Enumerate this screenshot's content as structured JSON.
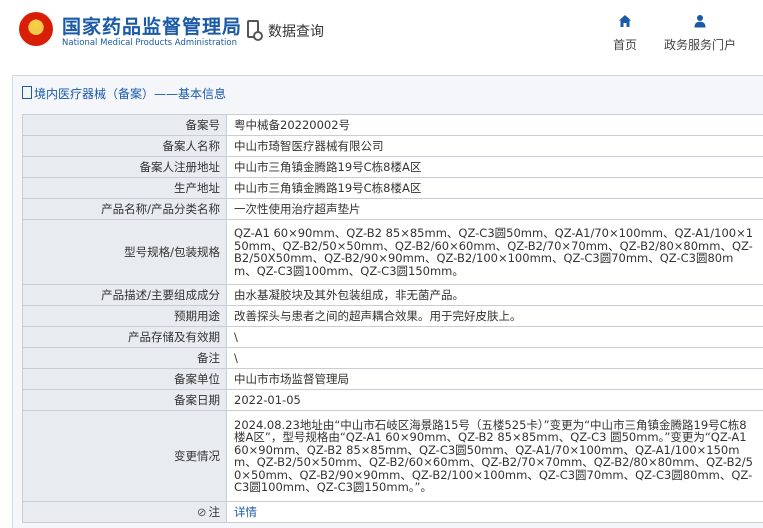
{
  "header": {
    "title": "国家药品监督管理局",
    "subtitle": "National Medical Products Administration",
    "query_label": "数据查询",
    "nav": {
      "home": "首页",
      "gov_portal": "政务服务门户"
    }
  },
  "panel": {
    "title": "境内医疗器械（备案）——基本信息",
    "rows": [
      {
        "label": "备案号",
        "value": "粤中械备20220002号"
      },
      {
        "label": "备案人名称",
        "value": "中山市琦智医疗器械有限公司"
      },
      {
        "label": "备案人注册地址",
        "value": "中山市三角镇金腾路19号C栋8楼A区"
      },
      {
        "label": "生产地址",
        "value": "中山市三角镇金腾路19号C栋8楼A区"
      },
      {
        "label": "产品名称/产品分类名称",
        "value": "一次性使用治疗超声垫片"
      },
      {
        "label": "型号规格/包装规格",
        "value": "QZ-A1 60×90mm、QZ-B2 85×85mm、QZ-C3圆50mm、QZ-A1/70×100mm、QZ-A1/100×150mm、QZ-B2/50×50mm、QZ-B2/60×60mm、QZ-B2/70×70mm、QZ-B2/80×80mm、QZ-B2/50X50mm、QZ-B2/90×90mm、QZ-B2/100×100mm、QZ-C3圆70mm、QZ-C3圆80mm、QZ-C3圆100mm、QZ-C3圆150mm。"
      },
      {
        "label": "产品描述/主要组成成分",
        "value": "由水基凝胶块及其外包装组成，非无菌产品。"
      },
      {
        "label": "预期用途",
        "value": "改善探头与患者之间的超声耦合效果。用于完好皮肤上。"
      },
      {
        "label": "产品存储及有效期",
        "value": "\\"
      },
      {
        "label": "备注",
        "value": "\\"
      },
      {
        "label": "备案单位",
        "value": "中山市市场监督管理局"
      },
      {
        "label": "备案日期",
        "value": "2022-01-05"
      },
      {
        "label": "变更情况",
        "value": "2024.08.23地址由“中山市石岐区海景路15号（五楼525卡）”变更为“中山市三角镇金腾路19号C栋8楼A区”，型号规格由“QZ-A1 60×90mm、QZ-B2 85×85mm、QZ-C3 圆50mm。”变更为“QZ-A1 60×90mm、QZ-B2 85×85mm、QZ-C3圆50mm、QZ-A1/70×100mm、QZ-A1/100×150mm、QZ-B2/50×50mm、QZ-B2/60×60mm、QZ-B2/70×70mm、QZ-B2/80×80mm、QZ-B2/50×50mm、QZ-B2/90×90mm、QZ-B2/100×100mm、QZ-C3圆70mm、QZ-C3圆80mm、QZ-C3圆100mm、QZ-C3圆150mm。”。"
      },
      {
        "label": "注",
        "value": "详情"
      }
    ]
  }
}
